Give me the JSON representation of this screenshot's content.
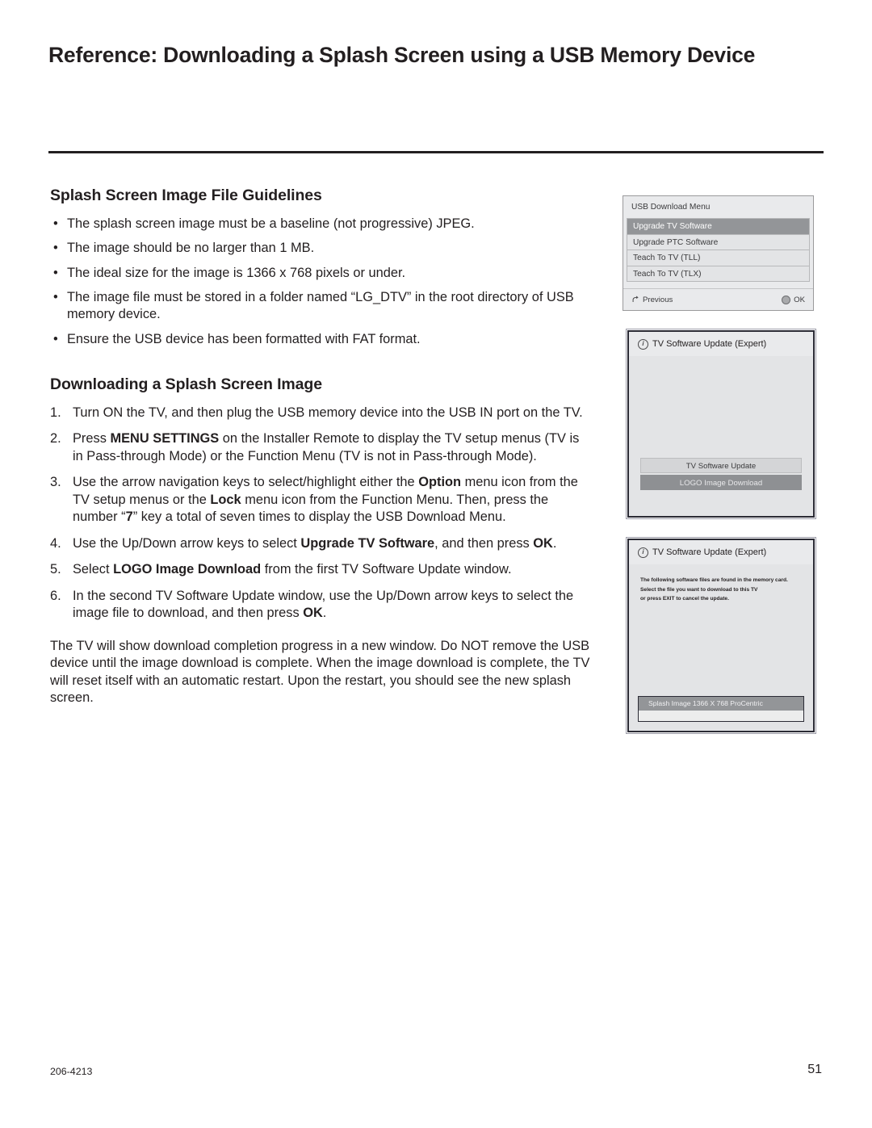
{
  "page": {
    "title": "Reference: Downloading a Splash Screen using a USB Memory Device",
    "footer_left": "206-4213",
    "footer_right": "51"
  },
  "guidelines": {
    "heading": "Splash Screen Image File Guidelines",
    "bullet_marker": "•",
    "items": [
      "The splash screen image must be a baseline (not progressive) JPEG.",
      "The image should be no larger than 1 MB.",
      "The ideal size for the image is 1366 x 768 pixels or under.",
      "The image file must be stored in a folder named “LG_DTV” in the root directory of USB memory device.",
      "Ensure the USB device has been formatted with FAT format."
    ]
  },
  "downloading": {
    "heading": "Downloading a Splash Screen Image",
    "steps": [
      {
        "num": "1.",
        "html": "Turn ON the TV, and then plug the USB memory device into the USB IN port on the TV."
      },
      {
        "num": "2.",
        "html": "Press <b>MENU SETTINGS</b> on the Installer Remote to display the TV setup menus (TV is in Pass-through Mode) or the Function Menu (TV is not in Pass-through Mode)."
      },
      {
        "num": "3.",
        "html": "Use the arrow navigation keys to select/highlight either the <b>Option</b> menu icon from the TV setup menus or the <b>Lock</b> menu icon from the Function Menu. Then, press the number “<b>7</b>” key a total of seven times to display the USB Download Menu."
      },
      {
        "num": "4.",
        "html": "Use the Up/Down arrow keys to select <b>Upgrade TV Software</b>, and then press <b>OK</b>."
      },
      {
        "num": "5.",
        "html": "Select <b>LOGO Image Download</b> from the first TV Software Update window."
      },
      {
        "num": "6.",
        "html": "In the second TV Software Update window, use the Up/Down arrow keys to select the image file to download, and then press <b>OK</b>."
      }
    ],
    "closing_paragraph": "The TV will show download completion progress in a new window. Do NOT remove the USB device until the image download is complete. When the image download is complete, the TV will reset itself with an automatic restart. Upon the restart, you should see the new splash screen."
  },
  "usb_download_menu": {
    "title": "USB Download Menu",
    "rows": [
      {
        "label": "Upgrade TV Software",
        "selected": true
      },
      {
        "label": "Upgrade PTC Software",
        "selected": false
      },
      {
        "label": "Teach To TV (TLL)",
        "selected": false
      },
      {
        "label": "Teach To TV (TLX)",
        "selected": false
      }
    ],
    "footer_previous": "Previous",
    "footer_ok": "OK"
  },
  "sw_update_1": {
    "title": "TV Software Update (Expert)",
    "buttons": [
      {
        "label": "TV Software Update",
        "selected": false
      },
      {
        "label": "LOGO Image Download",
        "selected": true
      }
    ]
  },
  "sw_update_2": {
    "title": "TV Software Update (Expert)",
    "note_lines": [
      "The following software files are found in the memory card.",
      "Select the file you want to download to this TV",
      "or press EXIT to cancel the update."
    ],
    "files": [
      {
        "label": "Splash Image 1366 X 768 ProCentric",
        "selected": true
      }
    ]
  },
  "colors": {
    "panel_bg": "#e3e4e6",
    "panel_title_bg": "#e9eaec",
    "selection": "#939598",
    "text": "#231f20",
    "rule": "#231f20"
  }
}
